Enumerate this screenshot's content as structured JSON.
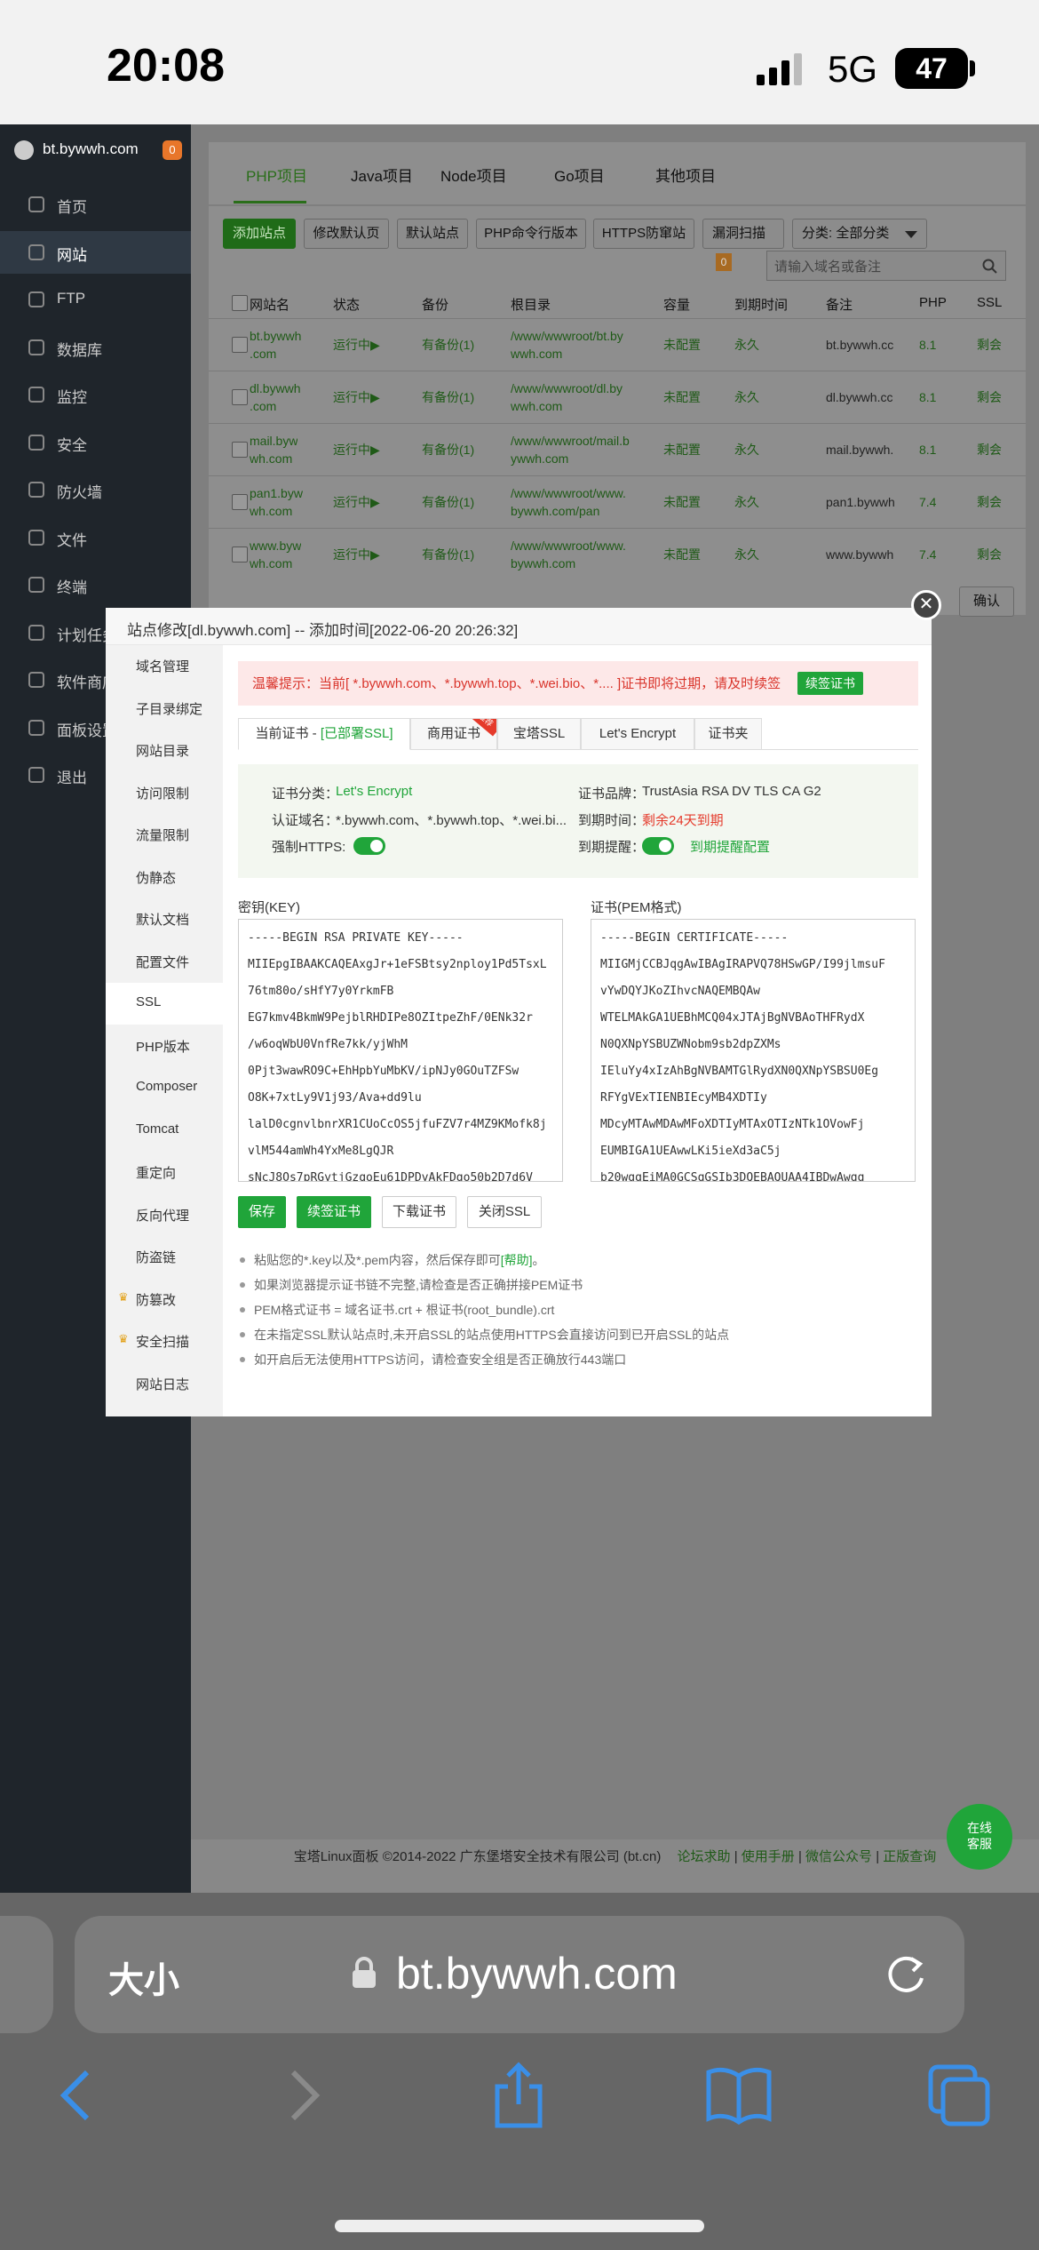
{
  "status_bar": {
    "time": "20:08",
    "network": "5G",
    "battery": "47"
  },
  "sidebar": {
    "site": "bt.bywwh.com",
    "badge": "0",
    "items": [
      {
        "label": "首页",
        "icon": "home-icon"
      },
      {
        "label": "网站",
        "icon": "globe-icon"
      },
      {
        "label": "FTP",
        "icon": "ftp-icon"
      },
      {
        "label": "数据库",
        "icon": "database-icon"
      },
      {
        "label": "监控",
        "icon": "monitor-icon"
      },
      {
        "label": "安全",
        "icon": "shield-icon"
      },
      {
        "label": "防火墙",
        "icon": "firewall-icon"
      },
      {
        "label": "文件",
        "icon": "folder-icon"
      },
      {
        "label": "终端",
        "icon": "terminal-icon"
      },
      {
        "label": "计划任务",
        "icon": "clock-icon"
      },
      {
        "label": "软件商店",
        "icon": "store-icon"
      },
      {
        "label": "面板设置",
        "icon": "gear-icon"
      },
      {
        "label": "退出",
        "icon": "logout-icon"
      }
    ]
  },
  "top_tabs": [
    "PHP项目",
    "Java项目",
    "Node项目",
    "Go项目",
    "其他项目"
  ],
  "toolbar": {
    "add_site": "添加站点",
    "modify_default": "修改默认页",
    "default_site": "默认站点",
    "php_cli": "PHP命令行版本",
    "https_guard": "HTTPS防窜站",
    "vuln_scan": "漏洞扫描",
    "vuln_count": "0",
    "category": "分类: 全部分类",
    "search_placeholder": "请输入域名或备注"
  },
  "table": {
    "headers": [
      "网站名",
      "状态",
      "备份",
      "根目录",
      "容量",
      "到期时间",
      "备注",
      "PHP",
      "SSL"
    ],
    "rows": [
      {
        "name": "bt.bywwh\n.com",
        "status": "运行中▶",
        "backup": "有备份(1)",
        "root": "/www/wwwroot/bt.by\nwwh.com",
        "quota": "未配置",
        "expire": "永久",
        "note": "bt.bywwh.cc",
        "php": "8.1",
        "ssl": "剩会"
      },
      {
        "name": "dl.bywwh\n.com",
        "status": "运行中▶",
        "backup": "有备份(1)",
        "root": "/www/wwwroot/dl.by\nwwh.com",
        "quota": "未配置",
        "expire": "永久",
        "note": "dl.bywwh.cc",
        "php": "8.1",
        "ssl": "剩会"
      },
      {
        "name": "mail.byw\nwh.com",
        "status": "运行中▶",
        "backup": "有备份(1)",
        "root": "/www/wwwroot/mail.b\nywwh.com",
        "quota": "未配置",
        "expire": "永久",
        "note": "mail.bywwh.",
        "php": "8.1",
        "ssl": "剩会"
      },
      {
        "name": "pan1.byw\nwh.com",
        "status": "运行中▶",
        "backup": "有备份(1)",
        "root": "/www/wwwroot/www.\nbywwh.com/pan",
        "quota": "未配置",
        "expire": "永久",
        "note": "pan1.bywwh",
        "php": "7.4",
        "ssl": "剩会"
      },
      {
        "name": "www.byw\nwh.com",
        "status": "运行中▶",
        "backup": "有备份(1)",
        "root": "/www/wwwroot/www.\nbywwh.com",
        "quota": "未配置",
        "expire": "永久",
        "note": "www.bywwh",
        "php": "7.4",
        "ssl": "剩会"
      }
    ],
    "confirm": "确认"
  },
  "modal": {
    "title": "站点修改[dl.bywwh.com] -- 添加时间[2022-06-20 20:26:32]",
    "nav": [
      "域名管理",
      "子目录绑定",
      "网站目录",
      "访问限制",
      "流量限制",
      "伪静态",
      "默认文档",
      "配置文件",
      "SSL",
      "PHP版本",
      "Composer",
      "Tomcat",
      "重定向",
      "反向代理",
      "防盗链",
      "防篡改",
      "安全扫描",
      "网站日志"
    ],
    "warning": "温馨提示：当前[ *.bywwh.com、*.bywwh.top、*.wei.bio、*.... ]证书即将过期，请及时续签",
    "renew_label": "续签证书",
    "ssl_tabs": [
      "当前证书 - ",
      "[已部署SSL]",
      "商用证书",
      "宝塔SSL",
      "Let's Encrypt",
      "证书夹"
    ],
    "ribbon": "推荐",
    "cert": {
      "category_label": "证书分类：",
      "category": "Let's Encrypt",
      "brand_label": "证书品牌：",
      "brand": "TrustAsia RSA DV TLS CA G2",
      "domain_label": "认证域名：",
      "domain": "*.bywwh.com、*.bywwh.top、*.wei.bi...",
      "expire_label": "到期时间：",
      "expire": "剩余24天到期",
      "force_https": "强制HTTPS:",
      "remind_label": "到期提醒：",
      "remind_config": "到期提醒配置"
    },
    "key_label": "密钥(KEY)",
    "cert_label": "证书(PEM格式)",
    "key_lines": [
      "-----BEGIN RSA PRIVATE KEY-----",
      "MIIEpgIBAAKCAQEAxgJr+1eFSBtsy2nploy1Pd5TsxL",
      "76tm80o/sHfY7y0YrkmFB",
      "EG7kmv4BkmW9PejblRHDIPe8OZItpeZhF/0ENk32r",
      "/w6oqWbU0VnfRe7kk/yjWhM",
      "0Pjt3wawRO9C+EhHpbYuMbKV/ipNJy0GOuTZFSw",
      "O8K+7xtLy9V1j93/Ava+dd9lu",
      "lalD0cgnvlbnrXR1CUoCcOS5jfuFZV7r4MZ9KMofk8j",
      "vlM544amWh4YxMe8LgQJR",
      "sNcJ8Os7pRGytjGzqoEu61DPDyAkFDgo50b2D7d6V"
    ],
    "cert_lines": [
      "-----BEGIN CERTIFICATE-----",
      "MIIGMjCCBJqgAwIBAgIRAPVQ78HSwGP/I99jlmsuF",
      "vYwDQYJKoZIhvcNAQEMBQAw",
      "WTELMAkGA1UEBhMCQ04xJTAjBgNVBAoTHFRydX",
      "N0QXNpYSBUZWNobm9sb2dpZXMs",
      "IEluYy4xIzAhBgNVBAMTGlRydXN0QXNpYSBSU0Eg",
      "RFYgVExTIENBIEcyMB4XDTIy",
      "MDcyMTAwMDAwMFoXDTIyMTAxOTIzNTk1OVowFj",
      "EUMBIGA1UEAwwLKi5ieXd3aC5j",
      "b20wggEiMA0GCSqGSIb3DQEBAQUAA4IBDwAwgg"
    ],
    "buttons": {
      "save": "保存",
      "renew": "续签证书",
      "download": "下载证书",
      "close_ssl": "关闭SSL"
    },
    "tips": [
      {
        "text": "粘贴您的*.key以及*.pem内容，然后保存即可",
        "link": "[帮助]",
        "suffix": "。"
      },
      {
        "text": "如果浏览器提示证书链不完整,请检查是否正确拼接PEM证书"
      },
      {
        "text": "PEM格式证书 = 域名证书.crt + 根证书(root_bundle).crt"
      },
      {
        "text": "在未指定SSL默认站点时,未开启SSL的站点使用HTTPS会直接访问到已开启SSL的站点"
      },
      {
        "text": "如开启后无法使用HTTPS访问，请检查安全组是否正确放行443端口"
      }
    ]
  },
  "footer": {
    "copyright": "宝塔Linux面板 ©2014-2022 广东堡塔安全技术有限公司 (bt.cn)",
    "links": [
      "论坛求助",
      "使用手册",
      "微信公众号",
      "正版查询"
    ]
  },
  "chat": {
    "line1": "在线",
    "line2": "客服"
  },
  "browser": {
    "text_size": "大小",
    "url": "bt.bywwh.com"
  }
}
